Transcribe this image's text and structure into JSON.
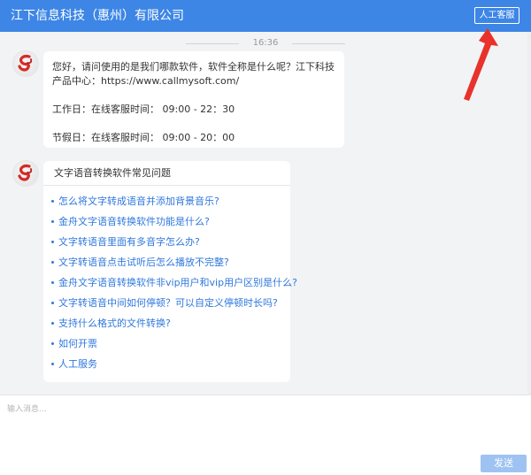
{
  "header": {
    "title": "江下信息科技（惠州）有限公司",
    "human_service_label": "人工客服"
  },
  "chat": {
    "timestamp": "16:36",
    "welcome": {
      "line1": "您好，请问使用的是我们哪款软件，软件全称是什么呢？江下科技产品中心：https://www.callmysoft.com/",
      "workday": "工作日：在线客服时间： 09:00 - 22：30",
      "holiday": "节假日：在线客服时间： 09:00 - 20：00"
    },
    "faq": {
      "title": "文字语音转换软件常见问题",
      "items": [
        "怎么将文字转成语音并添加背景音乐?",
        "金舟文字语音转换软件功能是什么?",
        "文字转语音里面有多音字怎么办?",
        "文字转语音点击试听后怎么播放不完整?",
        "金舟文字语音转换软件非vip用户和vip用户区别是什么?",
        "文字转语音中间如何停顿？可以自定义停顿时长吗?",
        "支持什么格式的文件转换?",
        "如何开票",
        "人工服务"
      ]
    }
  },
  "input": {
    "placeholder": "输入消息...",
    "send_label": "发送"
  },
  "colors": {
    "brand": "#3d86e6",
    "link": "#2f78dc",
    "send_button": "#9ec3f2",
    "annotation_arrow": "#e8322b"
  },
  "icons": {
    "avatar": "company-logo-icon",
    "annotation": "red-arrow-annotation"
  }
}
